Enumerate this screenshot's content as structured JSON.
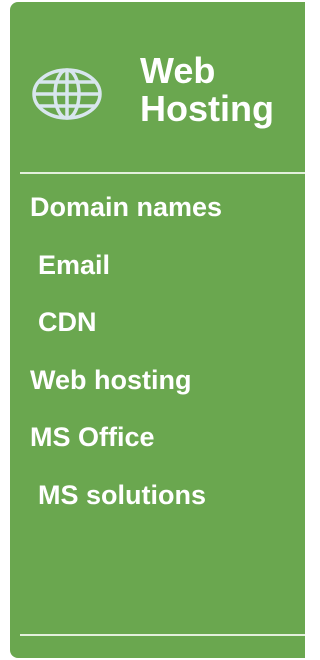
{
  "colors": {
    "panel_background": "#6aa74f",
    "text": "#ffffff",
    "icon_stroke": "#d8e6ee"
  },
  "header": {
    "icon": "globe-icon",
    "title_line1": "Web",
    "title_line2": "Hosting"
  },
  "menu": {
    "items": [
      {
        "label": "Domain names"
      },
      {
        "label": "Email"
      },
      {
        "label": "CDN"
      },
      {
        "label": "Web hosting"
      },
      {
        "label": "MS Office"
      },
      {
        "label": "MS solutions"
      }
    ]
  }
}
